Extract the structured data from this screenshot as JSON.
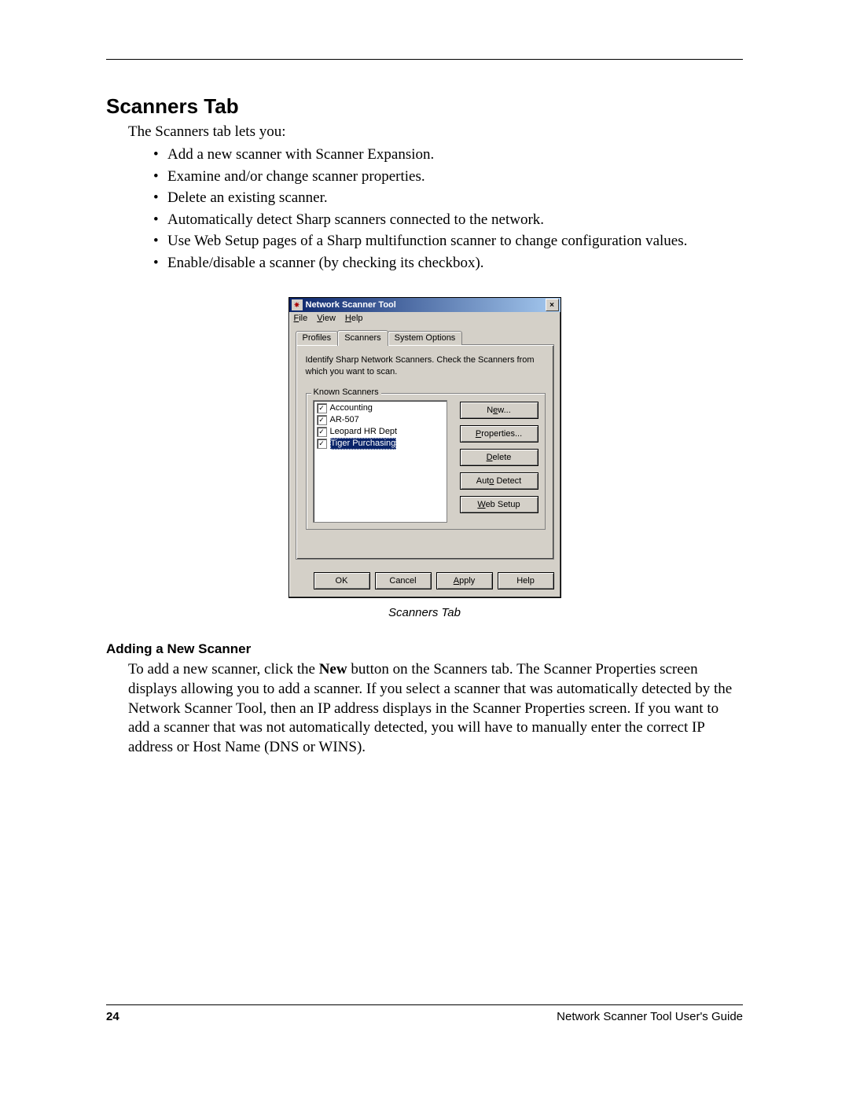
{
  "section_title": "Scanners Tab",
  "intro": "The Scanners tab lets you:",
  "bullets": [
    "Add a new scanner with Scanner Expansion.",
    "Examine and/or change scanner properties.",
    "Delete an existing scanner.",
    "Automatically detect Sharp scanners connected to the network.",
    "Use Web Setup pages of a Sharp multifunction scanner to change configuration values.",
    "Enable/disable a scanner (by checking its checkbox)."
  ],
  "dialog": {
    "title": "Network Scanner Tool",
    "menu": {
      "file": "File",
      "view": "View",
      "help": "Help"
    },
    "tabs": {
      "profiles": "Profiles",
      "scanners": "Scanners",
      "system_options": "System Options"
    },
    "instruction": "Identify Sharp Network Scanners. Check the Scanners from which you want to scan.",
    "groupbox_label": "Known Scanners",
    "scanners": [
      {
        "label": "Accounting",
        "checked": true,
        "selected": false
      },
      {
        "label": "AR-507",
        "checked": true,
        "selected": false
      },
      {
        "label": "Leopard HR Dept",
        "checked": true,
        "selected": false
      },
      {
        "label": "Tiger Purchasing",
        "checked": true,
        "selected": true
      }
    ],
    "side_buttons": {
      "new": "New...",
      "properties": "Properties...",
      "delete": "Delete",
      "auto_detect": "Auto Detect",
      "web_setup": "Web Setup"
    },
    "bottom_buttons": {
      "ok": "OK",
      "cancel": "Cancel",
      "apply": "Apply",
      "help": "Help"
    }
  },
  "caption": "Scanners Tab",
  "sub_heading": "Adding a New Scanner",
  "sub_body_pre": "To add a new scanner, click the ",
  "sub_body_bold": "New",
  "sub_body_post": " button on the Scanners tab. The Scanner Properties screen displays allowing you to add a scanner. If you select a scanner that was automatically detected by the Network Scanner Tool, then an IP address displays in the Scanner Properties screen. If you want to add a scanner that was not automatically detected, you will have to manually enter the correct IP address or Host Name (DNS or WINS).",
  "footer": {
    "page": "24",
    "guide": "Network Scanner Tool User's Guide"
  }
}
